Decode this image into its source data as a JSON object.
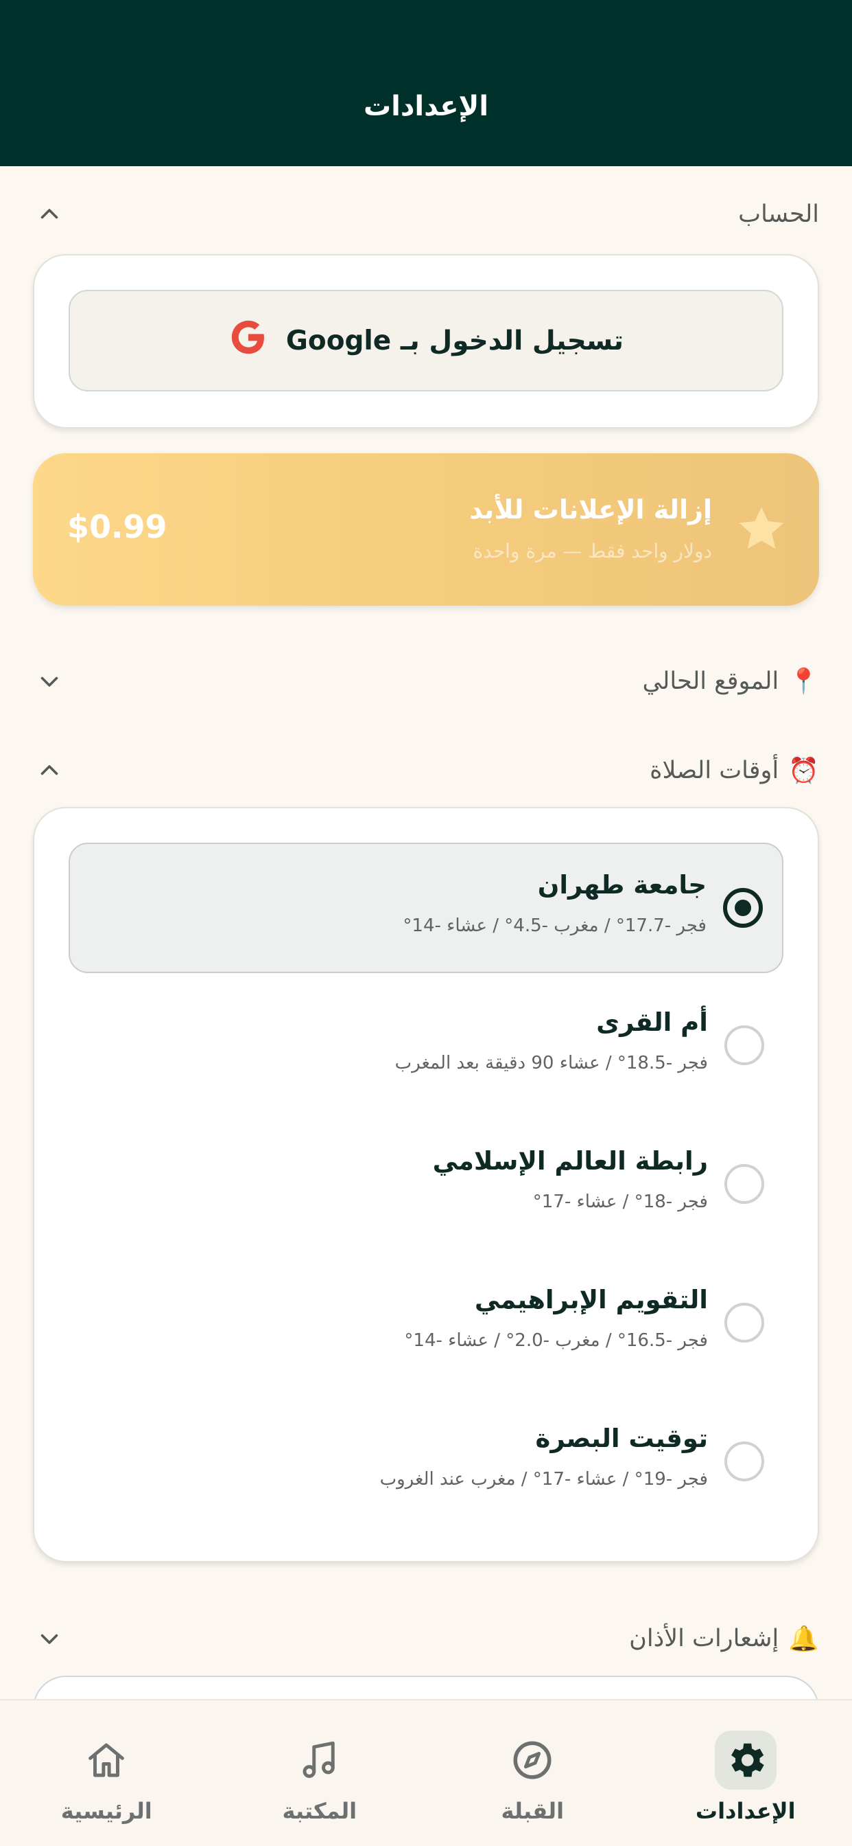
{
  "header": {
    "title": "الإعدادات"
  },
  "account": {
    "section_title": "الحساب",
    "google_button_label": "تسجيل الدخول بـ Google"
  },
  "premium": {
    "title": "إزالة الإعلانات للأبد",
    "subtitle": "دولار واحد فقط — مرة واحدة",
    "price": "$0.99"
  },
  "location": {
    "emoji": "📍",
    "section_title": "الموقع الحالي"
  },
  "prayer_times": {
    "emoji": "⏰",
    "section_title": "أوقات الصلاة",
    "selected_index": 0,
    "methods": [
      {
        "name": "جامعة طهران",
        "desc": "فجر -17.7° / مغرب -4.5° / عشاء -14°"
      },
      {
        "name": "أم القرى",
        "desc": "فجر -18.5° / عشاء 90 دقيقة بعد المغرب"
      },
      {
        "name": "رابطة العالم الإسلامي",
        "desc": "فجر -18° / عشاء -17°"
      },
      {
        "name": "التقويم الإبراهيمي",
        "desc": "فجر -16.5° / مغرب -2.0° / عشاء -14°"
      },
      {
        "name": "توقيت البصرة",
        "desc": "فجر -19° / عشاء -17° / مغرب عند الغروب"
      }
    ]
  },
  "adhan": {
    "emoji": "🔔",
    "section_title": "إشعارات الأذان"
  },
  "nav": {
    "items": [
      {
        "label": "الإعدادات",
        "icon": "gear-icon",
        "active": true
      },
      {
        "label": "القبلة",
        "icon": "compass-icon",
        "active": false
      },
      {
        "label": "المكتبة",
        "icon": "music-note-icon",
        "active": false
      },
      {
        "label": "الرئيسية",
        "icon": "home-icon",
        "active": false
      }
    ]
  },
  "colors": {
    "header_bg": "#00302a",
    "page_bg": "#fcf8f1",
    "primary": "#0f2a24",
    "premium_gradient_start": "#fdd78a",
    "premium_gradient_end": "#eec47a"
  }
}
